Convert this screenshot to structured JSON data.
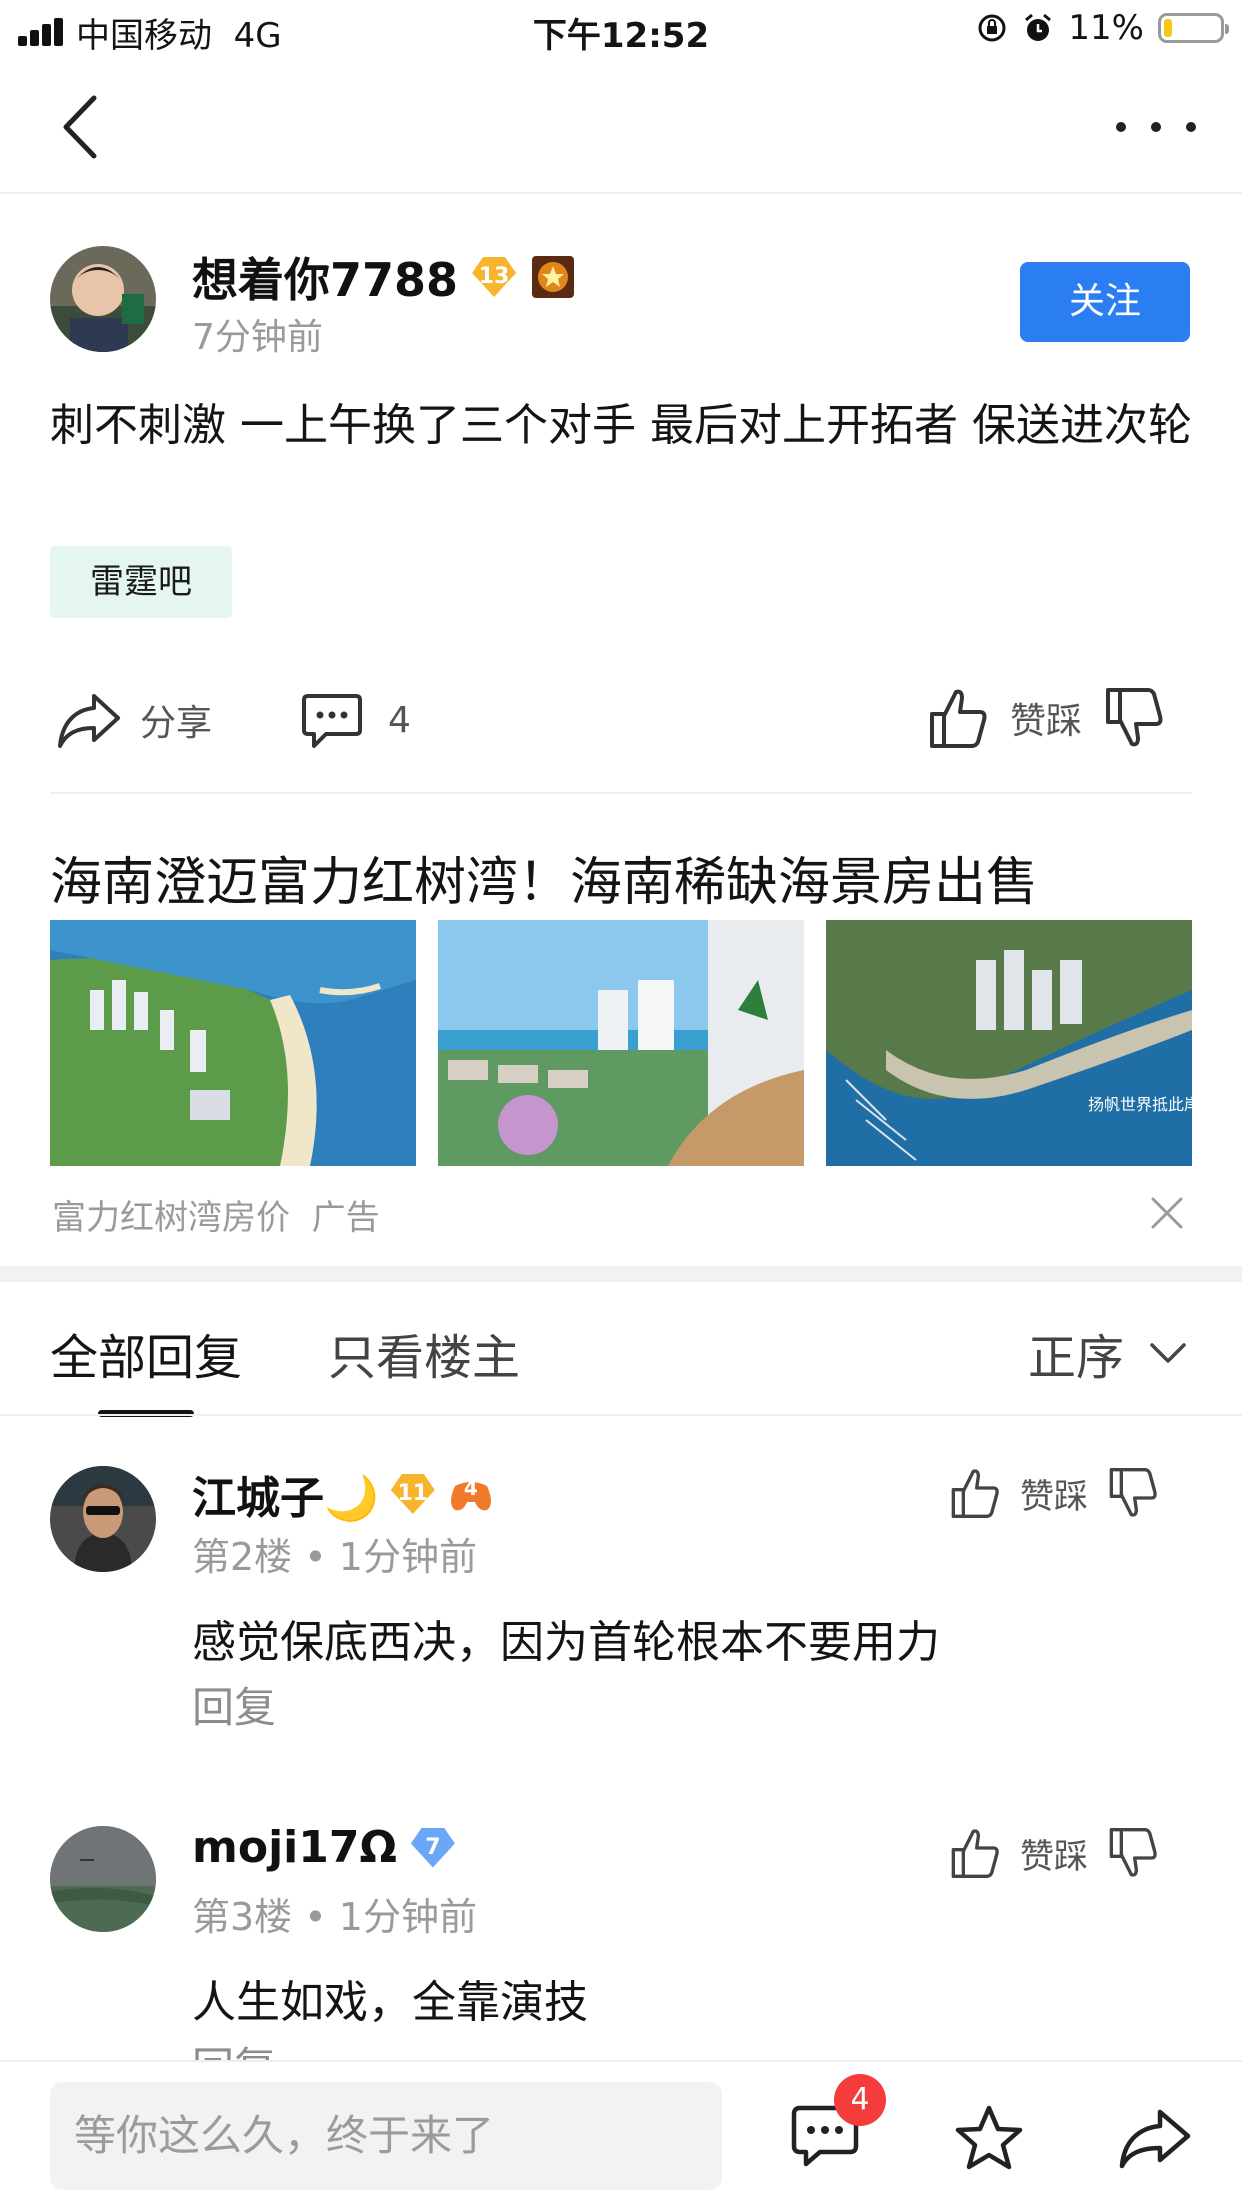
{
  "status_bar": {
    "carrier": "中国移动",
    "network": "4G",
    "time": "下午12:52",
    "battery": "11%"
  },
  "post": {
    "author": "想着你7788",
    "level": "13",
    "time": "7分钟前",
    "follow_label": "关注",
    "text": "刺不刺激 一上午换了三个对手 最后对上开拓者 保送进次轮",
    "tag": "雷霆吧",
    "share_label": "分享",
    "comment_count": "4",
    "vote_label": "赞踩"
  },
  "ad": {
    "title": "海南澄迈富力红树湾！海南稀缺海景房出售",
    "source": "富力红树湾房价",
    "label": "广告",
    "image_caption": "扬帆世界抵此岸"
  },
  "tabs": {
    "all": "全部回复",
    "op_only": "只看楼主",
    "sort": "正序"
  },
  "replies": [
    {
      "name": "江城子🌙",
      "level": "11",
      "extra_badge": "4",
      "floor": "第2楼",
      "time": "1分钟前",
      "text": "感觉保底西决，因为首轮根本不要用力",
      "reply_label": "回复",
      "vote_label": "赞踩"
    },
    {
      "name": "moji17Ω",
      "level": "7",
      "floor": "第3楼",
      "time": "1分钟前",
      "text": "人生如戏，全靠演技",
      "reply_label": "回复",
      "vote_label": "赞踩"
    }
  ],
  "bottom_bar": {
    "placeholder": "等你这么久，终于来了",
    "message_badge": "4"
  },
  "colors": {
    "accent_blue": "#2a7ef2",
    "tag_bg": "#e5f5ef",
    "badge_red": "#f43c3c",
    "level_gold": "#f7b52d",
    "level_blue": "#6aa8f7"
  }
}
